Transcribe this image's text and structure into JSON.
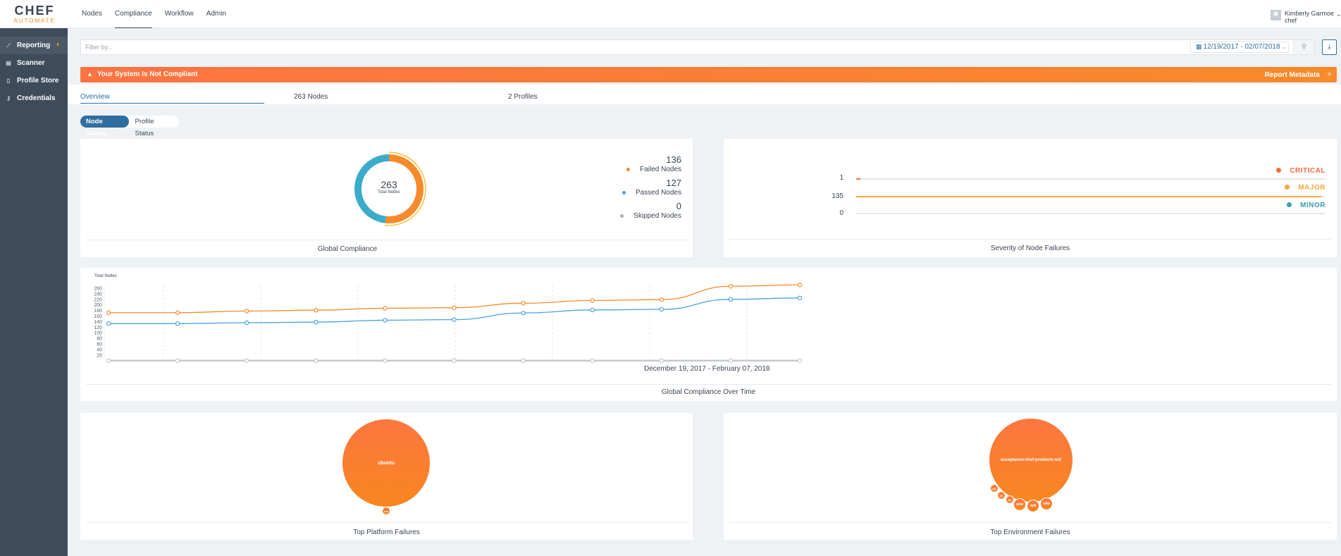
{
  "app": {
    "logo_top": "CHEF",
    "logo_bottom": "AUTOMATE"
  },
  "topnav": {
    "items": [
      {
        "label": "Nodes",
        "active": false
      },
      {
        "label": "Compliance",
        "active": true
      },
      {
        "label": "Workflow",
        "active": false
      },
      {
        "label": "Admin",
        "active": false
      }
    ]
  },
  "user": {
    "name": "Kimberly Garmoe",
    "org": "chef",
    "chevron": "⌄"
  },
  "sidebar": {
    "items": [
      {
        "label": "Reporting",
        "icon": "chart-icon",
        "glyph": "⟋",
        "active": true
      },
      {
        "label": "Scanner",
        "icon": "scanner-icon",
        "glyph": "▤",
        "active": false
      },
      {
        "label": "Profile Store",
        "icon": "document-icon",
        "glyph": "▯",
        "active": false
      },
      {
        "label": "Credentials",
        "icon": "key-icon",
        "glyph": "⚷",
        "active": false
      }
    ]
  },
  "filter": {
    "placeholder": "Filter by...",
    "value": "",
    "date_range": "12/19/2017 - 02/07/2018",
    "calendar_glyph": "▦",
    "caret_glyph": "⌄",
    "search_glyph": "⚲",
    "download_glyph": "⤓"
  },
  "banner": {
    "warning_glyph": "▲",
    "message": "Your System Is Not Compliant",
    "metadata_label": "Report Metadata",
    "plus_glyph": "+",
    "colors": {
      "start": "#ff7343",
      "end": "#f78a2a"
    }
  },
  "tabs": [
    {
      "label": "Overview",
      "active": true
    },
    {
      "label": "263 Nodes",
      "active": false
    },
    {
      "label": "2 Profiles",
      "active": false
    }
  ],
  "status_toggle": {
    "options": [
      {
        "label": "Node Status",
        "active": true
      },
      {
        "label": "Profile Status",
        "active": false
      }
    ]
  },
  "global_compliance": {
    "title": "Global Compliance",
    "total": "263",
    "total_label": "Total Nodes",
    "legend": [
      {
        "value": "136",
        "label": "Failed Nodes",
        "color": "#f78a2a"
      },
      {
        "value": "127",
        "label": "Passed Nodes",
        "color": "#4aa3dc"
      },
      {
        "value": "0",
        "label": "Skipped Nodes",
        "color": "#a8b0b8"
      }
    ],
    "chart_data": {
      "type": "pie",
      "title": "Global Compliance",
      "categories": [
        "Failed Nodes",
        "Passed Nodes",
        "Skipped Nodes"
      ],
      "values": [
        136,
        127,
        0
      ],
      "colors": [
        "#f78a2a",
        "#3cabc9",
        "#a8b0b8"
      ]
    }
  },
  "severity": {
    "title": "Severity of Node Failures",
    "rows": [
      {
        "count": "1",
        "key": "CRITICAL",
        "color": "#f56b3a",
        "fraction": 0.007
      },
      {
        "count": "135",
        "key": "MAJOR",
        "color": "#f7a73a",
        "fraction": 0.993
      },
      {
        "count": "0",
        "key": "MINOR",
        "color": "#3a9eae",
        "fraction": 0
      }
    ]
  },
  "over_time": {
    "title": "Global Compliance Over Time",
    "ylabel": "Total Nodes",
    "date_range_label": "December 19, 2017 - February 07, 2018",
    "chart_data": {
      "type": "line",
      "title": "Global Compliance Over Time",
      "ylabel": "Total Nodes",
      "xlabel": "December 19, 2017 - February 07, 2018",
      "yticks": [
        20,
        40,
        60,
        80,
        100,
        120,
        140,
        160,
        180,
        200,
        220,
        240,
        260
      ],
      "ylim": [
        0,
        270
      ],
      "x": [
        1,
        2,
        3,
        4,
        5,
        6,
        7,
        8,
        9,
        10,
        11
      ],
      "grid": "vertical-dashed",
      "series": [
        {
          "name": "Failed",
          "color": "#f78a2a",
          "values": [
            172,
            172,
            178,
            181,
            188,
            190,
            206,
            216,
            219,
            267,
            272
          ]
        },
        {
          "name": "Passed",
          "color": "#4aa3dc",
          "values": [
            133,
            133,
            136,
            138,
            145,
            147,
            171,
            182,
            184,
            220,
            225
          ]
        },
        {
          "name": "Skipped",
          "color": "#c4c9ce",
          "values": [
            0,
            0,
            0,
            0,
            0,
            0,
            0,
            0,
            0,
            0,
            0
          ]
        }
      ]
    }
  },
  "platform_failures": {
    "title": "Top Platform Failures",
    "bubbles": [
      {
        "label": "ubuntu"
      },
      {
        "label": "oin"
      }
    ]
  },
  "environment_failures": {
    "title": "Top Environment Failures",
    "bubbles": [
      {
        "label": "acceptance-chef-products-out"
      },
      {
        "label": "un"
      },
      {
        "label": "ac"
      },
      {
        "label": "ac"
      },
      {
        "label": "unio"
      },
      {
        "label": "dell"
      },
      {
        "label": "rehe"
      }
    ]
  }
}
